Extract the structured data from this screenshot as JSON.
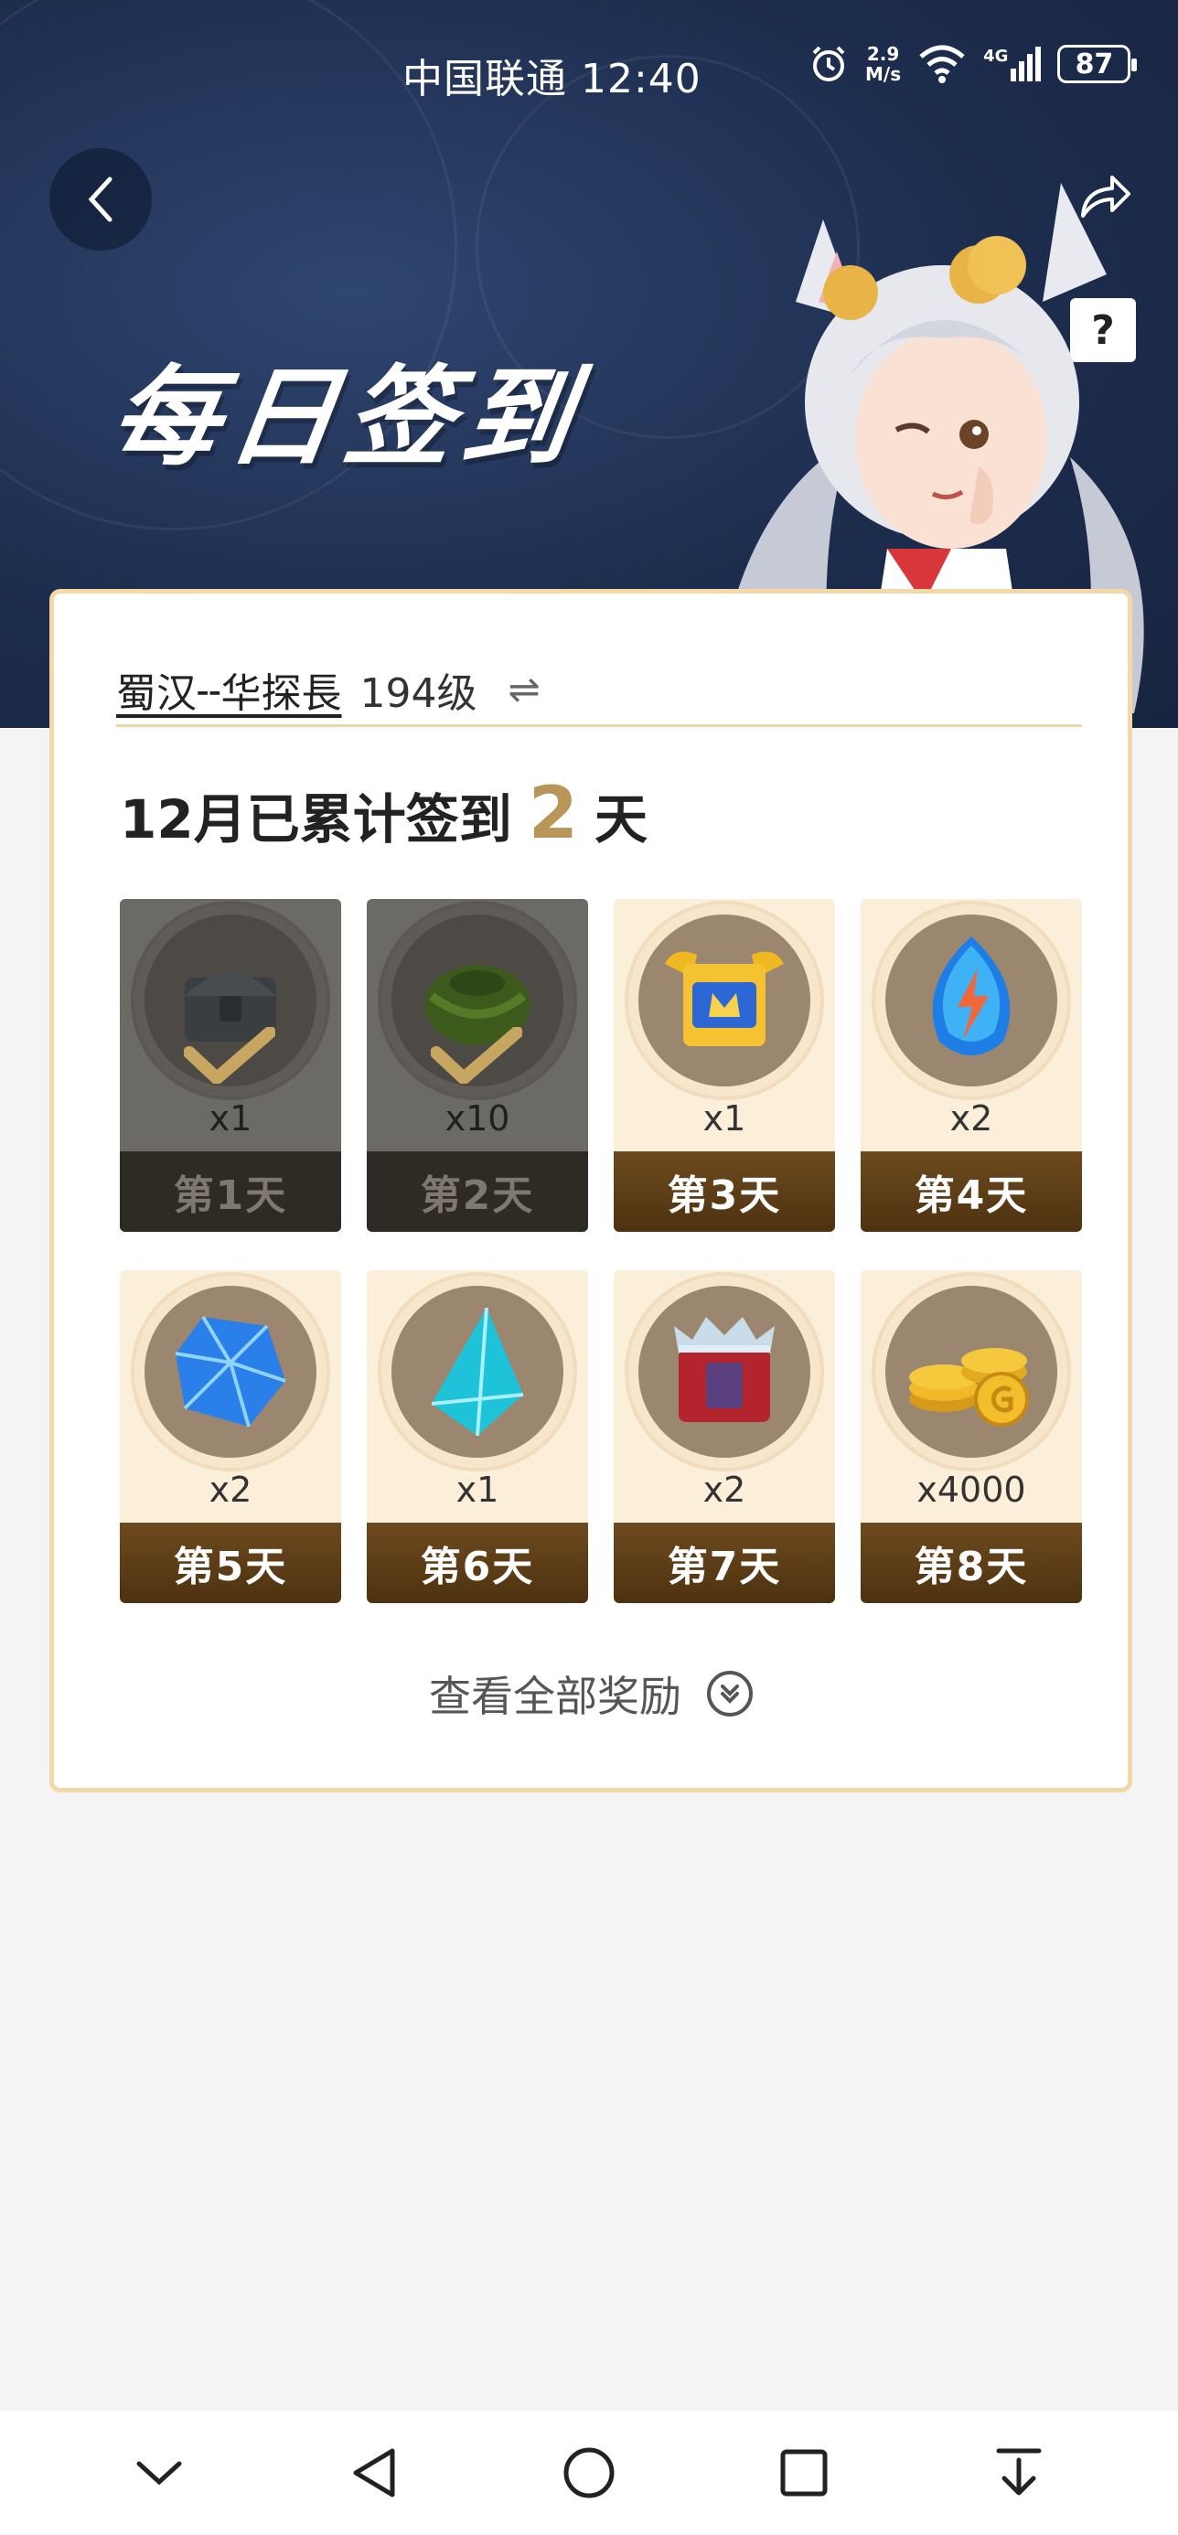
{
  "status_bar": {
    "carrier_time": "中国联通 12:40",
    "net_speed_value": "2.9",
    "net_speed_unit": "M/s",
    "network": "4G",
    "battery": "87"
  },
  "header": {
    "title": "每日签到",
    "help_label": "?"
  },
  "player": {
    "name": "蜀汉╌华探長",
    "level": "194级",
    "switch_icon": "⇌"
  },
  "summary": {
    "prefix": "12月已累计签到",
    "days": "2",
    "suffix": "天"
  },
  "rewards": [
    {
      "qty": "x1",
      "day": "第1天",
      "claimed": true,
      "icon": "chest-icon"
    },
    {
      "qty": "x10",
      "day": "第2天",
      "claimed": true,
      "icon": "herb-bundle-icon"
    },
    {
      "qty": "x1",
      "day": "第3天",
      "claimed": false,
      "icon": "golden-chest-icon"
    },
    {
      "qty": "x2",
      "day": "第4天",
      "claimed": false,
      "icon": "lightning-gem-icon"
    },
    {
      "qty": "x2",
      "day": "第5天",
      "claimed": false,
      "icon": "blue-crystal-icon"
    },
    {
      "qty": "x1",
      "day": "第6天",
      "claimed": false,
      "icon": "cyan-crystal-icon"
    },
    {
      "qty": "x2",
      "day": "第7天",
      "claimed": false,
      "icon": "red-chest-icon"
    },
    {
      "qty": "x4000",
      "day": "第8天",
      "claimed": false,
      "icon": "gold-coins-icon"
    }
  ],
  "view_all_label": "查看全部奖励",
  "colors": {
    "banner": "#1d2d4e",
    "card_border": "#f4d8a8",
    "accent_gold": "#b8965a",
    "day_bar": "#5a3b14"
  }
}
